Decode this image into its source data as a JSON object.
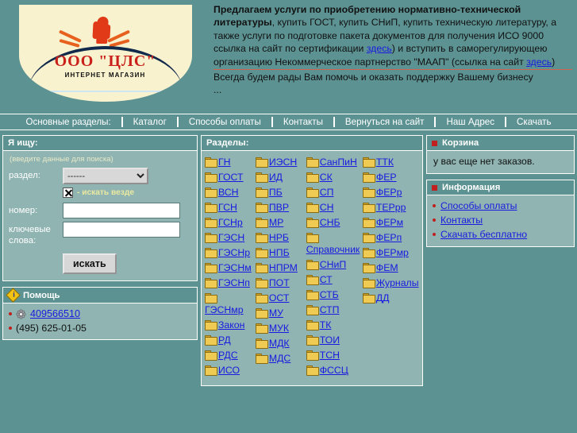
{
  "logo": {
    "title": "ООО \"ЦЛС\"",
    "subtitle": "ИНТЕРНЕТ МАГАЗИН"
  },
  "header": {
    "lead": "Предлагаем услуги по приобретению нормативно-технической литературы",
    "body_1": ",   купить ГОСТ, купить СНиП, купить техническую литературу, а также услуги по подготовке пакета документов для получения ИСО  9000 сcылка на сайт по сертификации ",
    "link_1": "здесь",
    "body_2": ") и вступить в саморегулирующею организацию Некоммерческое партнерство \"МААП\" (ссылка на сайт ",
    "link_2": "здесь",
    "body_3": ")",
    "footer_line": "Всегда будем рады Вам помочь и оказать поддержку Вашему бизнесу",
    "ellipsis": "..."
  },
  "nav": {
    "label": "Основные разделы:",
    "items": [
      {
        "label": "Каталог"
      },
      {
        "label": "Способы оплаты"
      },
      {
        "label": "Контакты"
      },
      {
        "label": "Вернуться на сайт"
      },
      {
        "label": "Наш Адрес"
      },
      {
        "label": "Скачать"
      }
    ]
  },
  "search": {
    "title": "Я ищу:",
    "hint": "(введите данные для поиска)",
    "section_label": "раздел:",
    "section_value": "------",
    "section_options": [
      "------"
    ],
    "everywhere_label": "- искать везде",
    "everywhere_checked": true,
    "number_label": "номер:",
    "number_value": "",
    "keywords_label": "ключевые слова:",
    "keywords_value": "",
    "submit_label": "искать"
  },
  "help": {
    "title": "Помощь",
    "icq": "409566510",
    "phone": "(495) 625-01-05"
  },
  "sections": {
    "title": "Разделы:",
    "columns": [
      [
        "ГН",
        "ГОСТ",
        "ВСН",
        "ГСН",
        "ГСНр",
        "ГЭСН",
        "ГЭСНр",
        "ГЭСНм",
        "ГЭСНп",
        "ГЭСНмр",
        "Закон",
        "РД",
        "РДС",
        "ИСО"
      ],
      [
        "ИЭСН",
        "ИД",
        "ПБ",
        "ПВР",
        "МР",
        "НРБ",
        "НПБ",
        "НПРМ",
        "ПОТ",
        "ОСТ",
        "МУ",
        "МУК",
        "МДК",
        "МДС"
      ],
      [
        "СанПиН",
        "СК",
        "СП",
        "СН",
        "СНБ",
        "Справочник",
        "СНиП",
        "СТ",
        "СТБ",
        "СТП",
        "ТК",
        "ТОИ",
        "ТСН",
        "ФССЦ"
      ],
      [
        "ТТК",
        "ФЕР",
        "ФЕРр",
        "ТЕРрр",
        "ФЕРм",
        "ФЕРп",
        "ФЕРмр",
        "ФЕМ",
        "Журналы",
        "ДД"
      ]
    ]
  },
  "cart": {
    "title": "Корзина",
    "empty_text": "у вас еще нет заказов."
  },
  "info": {
    "title": "Информация",
    "links": [
      "Способы оплаты",
      "Контакты",
      "Скачать бесплатно"
    ]
  },
  "colors": {
    "page_bg": "#5d9293",
    "panel_bg": "#8fb4b2",
    "link": "#1a1ae0",
    "accent_red": "#c02020",
    "logo_bg": "#f8f2cf",
    "divider_red": "#d0624f"
  }
}
